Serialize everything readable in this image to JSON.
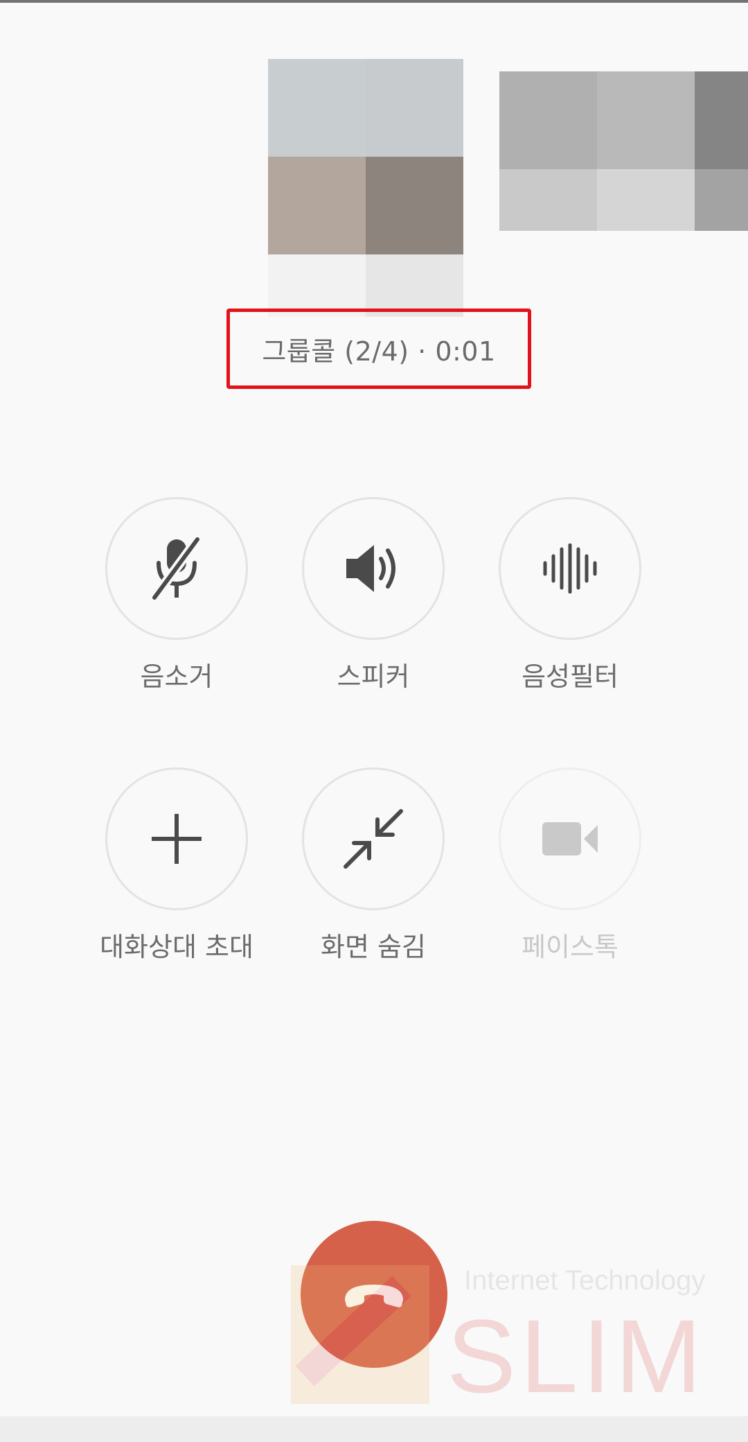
{
  "call": {
    "status_text": "그룹콜 (2/4) · 0:01"
  },
  "controls": {
    "mute_label": "음소거",
    "speaker_label": "스피커",
    "voice_filter_label": "음성필터",
    "invite_label": "대화상대 초대",
    "minimize_label": "화면 숨김",
    "facetalk_label": "페이스톡",
    "facetalk_enabled": false
  },
  "colors": {
    "highlight_box": "#e1131b",
    "end_call": "#d5614a",
    "icon": "#4a4a4a",
    "disabled_icon": "#c9c9c9"
  },
  "icons": {
    "mute": "microphone-slash-icon",
    "speaker": "speaker-volume-icon",
    "voice_filter": "waveform-icon",
    "invite": "plus-icon",
    "minimize": "arrows-inward-icon",
    "facetalk": "video-camera-icon",
    "end_call": "phone-hangup-icon"
  },
  "watermark": {
    "line1": "Internet Technology",
    "line2": "SLIM"
  }
}
